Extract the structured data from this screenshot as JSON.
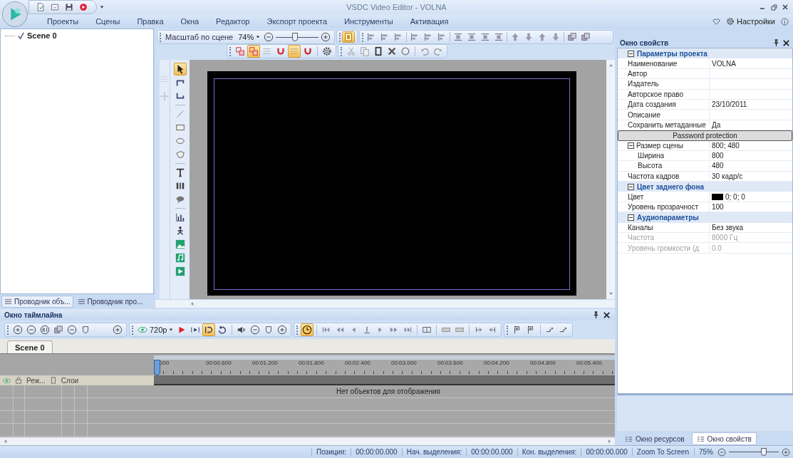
{
  "window": {
    "title": "VSDC Video Editor - VOLNA"
  },
  "quick_access": [
    {
      "kind": "new"
    },
    {
      "kind": "save"
    },
    {
      "kind": "disk"
    },
    {
      "kind": "record"
    }
  ],
  "menu": {
    "items": [
      {
        "label": "Проекты",
        "selected": false
      },
      {
        "label": "Сцены",
        "selected": false
      },
      {
        "label": "Правка",
        "selected": false
      },
      {
        "label": "Окна",
        "selected": false
      },
      {
        "label": "Редактор",
        "selected": false
      },
      {
        "label": "Экспорт проекта",
        "selected": false
      },
      {
        "label": "Инструменты",
        "selected": false
      },
      {
        "label": "Активация",
        "selected": false
      }
    ],
    "settings": "Настройки"
  },
  "explorer": {
    "tree": [
      {
        "label": "Scene 0"
      }
    ],
    "tabs": [
      {
        "label": "Проводник объ...",
        "selected": true
      },
      {
        "label": "Проводник про...",
        "selected": false
      }
    ]
  },
  "editor": {
    "zoom_label": "Масштаб по сцене",
    "zoom_value": "74%",
    "zoom_slider": {
      "level": 0.45
    },
    "toolbar_1": [
      [
        {
          "kind": "fit",
          "on": true
        }
      ],
      [
        {
          "kind": "align",
          "on": false
        },
        {
          "kind": "align",
          "on": false
        },
        {
          "kind": "align",
          "on": false
        },
        {
          "kind": "sep"
        },
        {
          "kind": "align",
          "on": false
        },
        {
          "kind": "align",
          "on": false
        },
        {
          "kind": "align",
          "on": false
        },
        {
          "kind": "sep"
        },
        {
          "kind": "distribute",
          "on": false
        },
        {
          "kind": "distribute",
          "on": false
        },
        {
          "kind": "distribute",
          "on": false
        },
        {
          "kind": "distribute",
          "on": false
        },
        {
          "kind": "sep"
        },
        {
          "kind": "up",
          "on": false
        },
        {
          "kind": "down",
          "on": false
        },
        {
          "kind": "up",
          "on": false
        },
        {
          "kind": "down",
          "on": false
        },
        {
          "kind": "sep"
        },
        {
          "kind": "layers",
          "on": false
        },
        {
          "kind": "layers",
          "on": false
        }
      ]
    ],
    "toolbar_2": [
      [
        {
          "kind": "snap",
          "on": false
        },
        {
          "kind": "snap",
          "on": true
        },
        {
          "kind": "grid",
          "on": false
        },
        {
          "kind": "magnet",
          "on": false
        },
        {
          "kind": "grid",
          "on": true
        },
        {
          "kind": "magnet",
          "on": false
        },
        {
          "kind": "sep"
        },
        {
          "kind": "gear",
          "on": false
        }
      ],
      [
        {
          "kind": "cut",
          "on": false
        },
        {
          "kind": "copy",
          "on": false
        },
        {
          "kind": "frame",
          "on": false
        },
        {
          "kind": "delete",
          "on": false
        },
        {
          "kind": "circle",
          "on": false
        },
        {
          "kind": "sep"
        },
        {
          "kind": "undo",
          "on": false
        },
        {
          "kind": "redo",
          "on": false
        }
      ]
    ],
    "toolbox_side": [
      {
        "kind": "grid",
        "on": false
      },
      {
        "kind": "move",
        "on": false
      }
    ],
    "toolbox": [
      {
        "kind": "cursor",
        "on": true
      },
      {
        "kind": "crop",
        "on": false
      },
      {
        "kind": "crop2",
        "on": false
      },
      {
        "kind": "sep"
      },
      {
        "kind": "line",
        "on": false
      },
      {
        "kind": "rect",
        "on": false
      },
      {
        "kind": "ellipse",
        "on": false
      },
      {
        "kind": "polygon",
        "on": false
      },
      {
        "kind": "sep"
      },
      {
        "kind": "text",
        "on": false
      },
      {
        "kind": "subtitle",
        "on": false
      },
      {
        "kind": "bubble",
        "on": false
      },
      {
        "kind": "sep"
      },
      {
        "kind": "chart",
        "on": false
      },
      {
        "kind": "figure",
        "on": false
      },
      {
        "kind": "image",
        "on": false
      },
      {
        "kind": "audio",
        "on": false
      },
      {
        "kind": "video",
        "on": false
      }
    ]
  },
  "properties": {
    "title": "Окно свойств",
    "groups": [
      {
        "title": "Параметры проекта",
        "expanded": true,
        "rows": [
          {
            "label": "Наименование",
            "value": "VOLNA",
            "disabled": false
          },
          {
            "label": "Автор",
            "disabled": false
          },
          {
            "label": "Издатель",
            "disabled": false
          },
          {
            "label": "Авторское право",
            "disabled": false
          },
          {
            "label": "Дата создания",
            "value": "23/10/2011",
            "disabled": false
          },
          {
            "label": "Описание",
            "disabled": false
          },
          {
            "label": "Сохранить метаданные",
            "value": "Да",
            "disabled": false
          },
          {
            "kind": "button",
            "label": "Password protection",
            "disabled": false
          },
          {
            "label": "Размер сцены",
            "value": "800; 480",
            "disabled": false,
            "expanded": true,
            "children": [
              {
                "label": "Ширина",
                "value": "800",
                "disabled": false
              },
              {
                "label": "Высота",
                "value": "480",
                "disabled": false
              }
            ]
          },
          {
            "label": "Частота кадров",
            "value": "30 кадр/с",
            "disabled": false
          }
        ]
      },
      {
        "title": "Цвет заднего фона",
        "expanded": true,
        "rows": [
          {
            "label": "Цвет",
            "value": "0; 0; 0",
            "color": "#000000",
            "disabled": false
          },
          {
            "label": "Уровень прозрачност",
            "value": "100",
            "disabled": false
          }
        ]
      },
      {
        "title": "Аудиопараметры",
        "expanded": true,
        "rows": [
          {
            "label": "Каналы",
            "value": "Без звука",
            "disabled": false
          },
          {
            "label": "Частота",
            "value": "8000 Гц",
            "disabled": true
          },
          {
            "label": "Уровень громкости (д",
            "value": "0.0",
            "disabled": true
          }
        ]
      }
    ],
    "tabs": [
      {
        "label": "Окно ресурсов",
        "selected": false
      },
      {
        "label": "Окно свойств",
        "selected": true
      }
    ]
  },
  "timeline": {
    "title": "Окно таймлайна",
    "toolbar": [
      [
        {
          "kind": "plus",
          "on": false
        },
        {
          "kind": "minus",
          "on": false
        },
        {
          "kind": "fit-h",
          "on": false
        },
        {
          "kind": "layers",
          "on": false
        },
        {
          "kind": "minus",
          "on": false
        },
        {
          "kind": "shield",
          "on": false
        },
        {
          "kind": "plus",
          "on": false
        }
      ],
      [
        {
          "kind": "resolution",
          "label": "720p",
          "on": false
        },
        {
          "kind": "play",
          "on": false
        },
        {
          "kind": "frame-play",
          "on": false
        },
        {
          "kind": "loop",
          "on": true
        },
        {
          "kind": "rotate",
          "on": false
        },
        {
          "kind": "sep"
        },
        {
          "kind": "speaker",
          "on": false
        },
        {
          "kind": "minus",
          "on": false
        },
        {
          "kind": "shield",
          "on": false
        },
        {
          "kind": "plus",
          "on": false
        }
      ],
      [
        {
          "kind": "clock",
          "on": true
        },
        {
          "kind": "sep"
        },
        {
          "kind": "skip-start",
          "on": false
        },
        {
          "kind": "rewind",
          "on": false
        },
        {
          "kind": "step-back",
          "on": false
        },
        {
          "kind": "marker",
          "on": false
        },
        {
          "kind": "step-forward",
          "on": false
        },
        {
          "kind": "fast-forward",
          "on": false
        },
        {
          "kind": "skip-end",
          "on": false
        },
        {
          "kind": "sep"
        },
        {
          "kind": "split",
          "on": false
        },
        {
          "kind": "sep"
        },
        {
          "kind": "clip",
          "on": false
        },
        {
          "kind": "clip",
          "on": false
        },
        {
          "kind": "sep"
        },
        {
          "kind": "trim-in",
          "on": false
        },
        {
          "kind": "trim-out",
          "on": false
        }
      ],
      [
        {
          "kind": "flag",
          "on": false
        },
        {
          "kind": "flag",
          "on": false
        },
        {
          "kind": "sep"
        },
        {
          "kind": "link",
          "on": false
        },
        {
          "kind": "link",
          "on": false
        }
      ]
    ],
    "tabs": [
      {
        "label": "Scene 0",
        "selected": true
      }
    ],
    "ruler": [
      "000",
      "00:00.600",
      "00:01.200",
      "00:01.800",
      "00:02.400",
      "00:03.000",
      "00:03.600",
      "00:04.200",
      "00:04.800",
      "00:05.400"
    ],
    "layer_header": [
      "Реж...",
      "Слои"
    ],
    "empty_message": "Нет объектов для отображения"
  },
  "status_bar": {
    "fields": [
      {
        "label": "Позиция:",
        "value": "00:00:00.000"
      },
      {
        "label": "Нач. выделения:",
        "value": "00:00:00.000"
      },
      {
        "label": "Кон. выделения:",
        "value": "00:00:00.000"
      }
    ],
    "zoom_button": "Zoom To Screen",
    "zoom_value": "75%",
    "zoom_slider": {
      "level": 0.7
    }
  }
}
